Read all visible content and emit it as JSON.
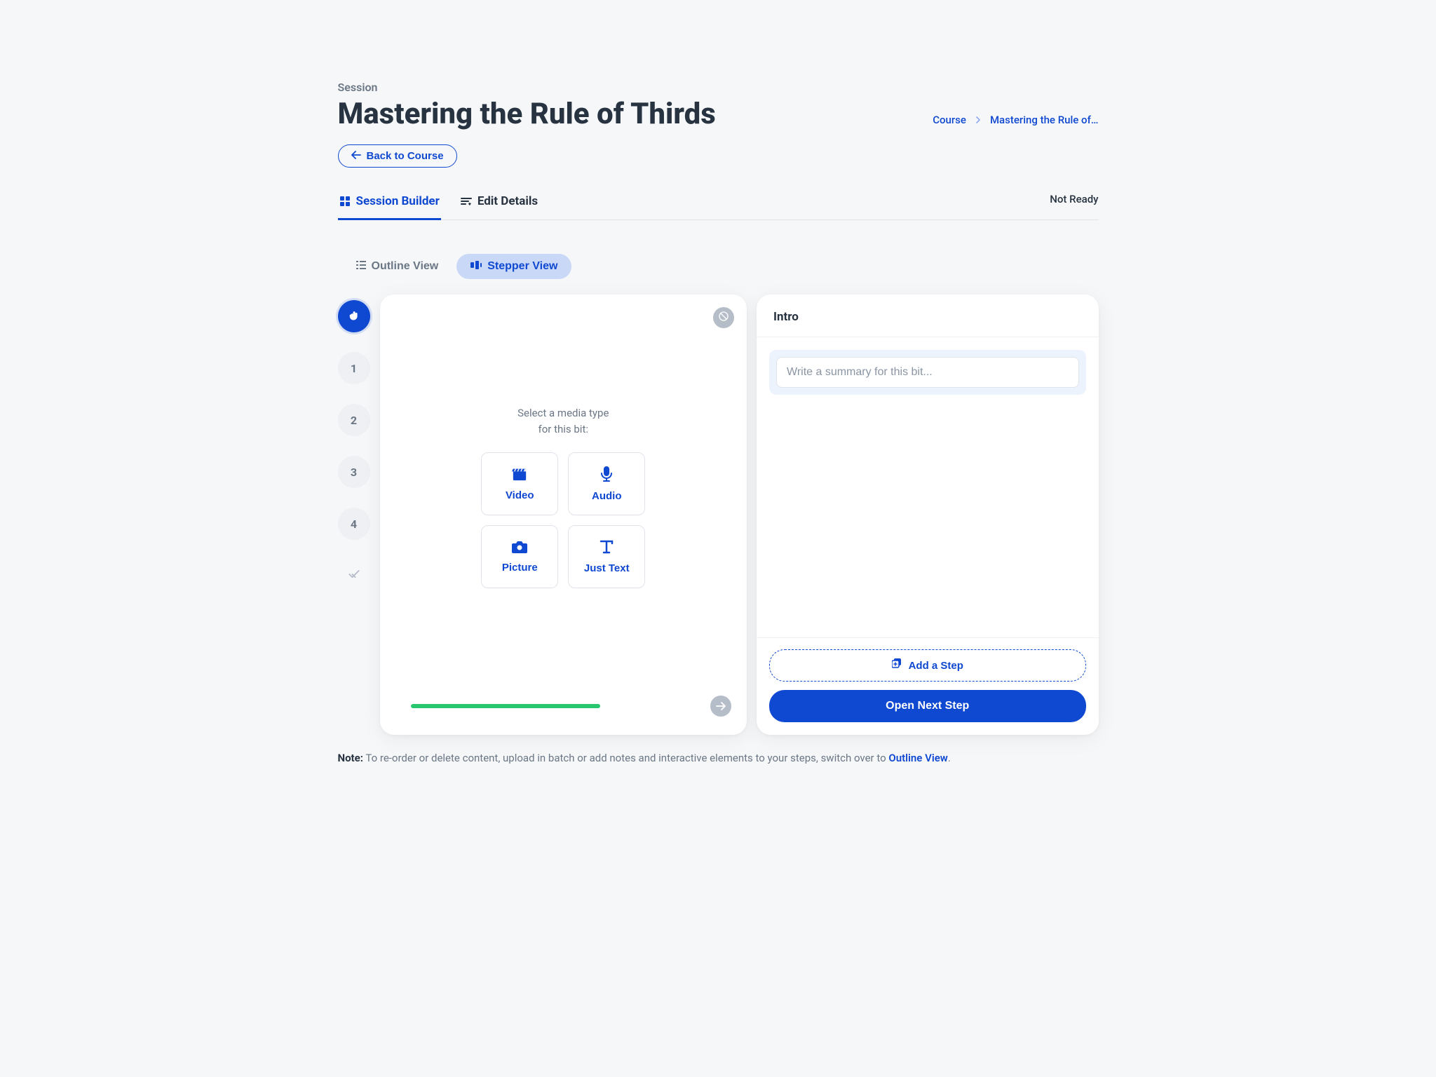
{
  "header": {
    "subtitle": "Session",
    "title": "Mastering the Rule of Thirds",
    "back_label": "Back to Course"
  },
  "breadcrumb": {
    "root": "Course",
    "current": "Mastering the Rule of…"
  },
  "tabs": {
    "builder": "Session Builder",
    "edit": "Edit Details"
  },
  "status": "Not Ready",
  "views": {
    "outline": "Outline View",
    "stepper": "Stepper View"
  },
  "stepper": {
    "items": [
      "1",
      "2",
      "3",
      "4"
    ]
  },
  "media": {
    "prompt_line1": "Select a media type",
    "prompt_line2": "for this bit:",
    "video": "Video",
    "audio": "Audio",
    "picture": "Picture",
    "text": "Just Text"
  },
  "intro": {
    "title": "Intro",
    "summary_placeholder": "Write a summary for this bit..."
  },
  "actions": {
    "add_step": "Add a Step",
    "open_next": "Open Next Step"
  },
  "note": {
    "prefix": "Note:",
    "body": " To re-order or delete content, upload in batch or add notes and interactive elements to your steps, switch over to ",
    "link": "Outline View",
    "suffix": "."
  }
}
